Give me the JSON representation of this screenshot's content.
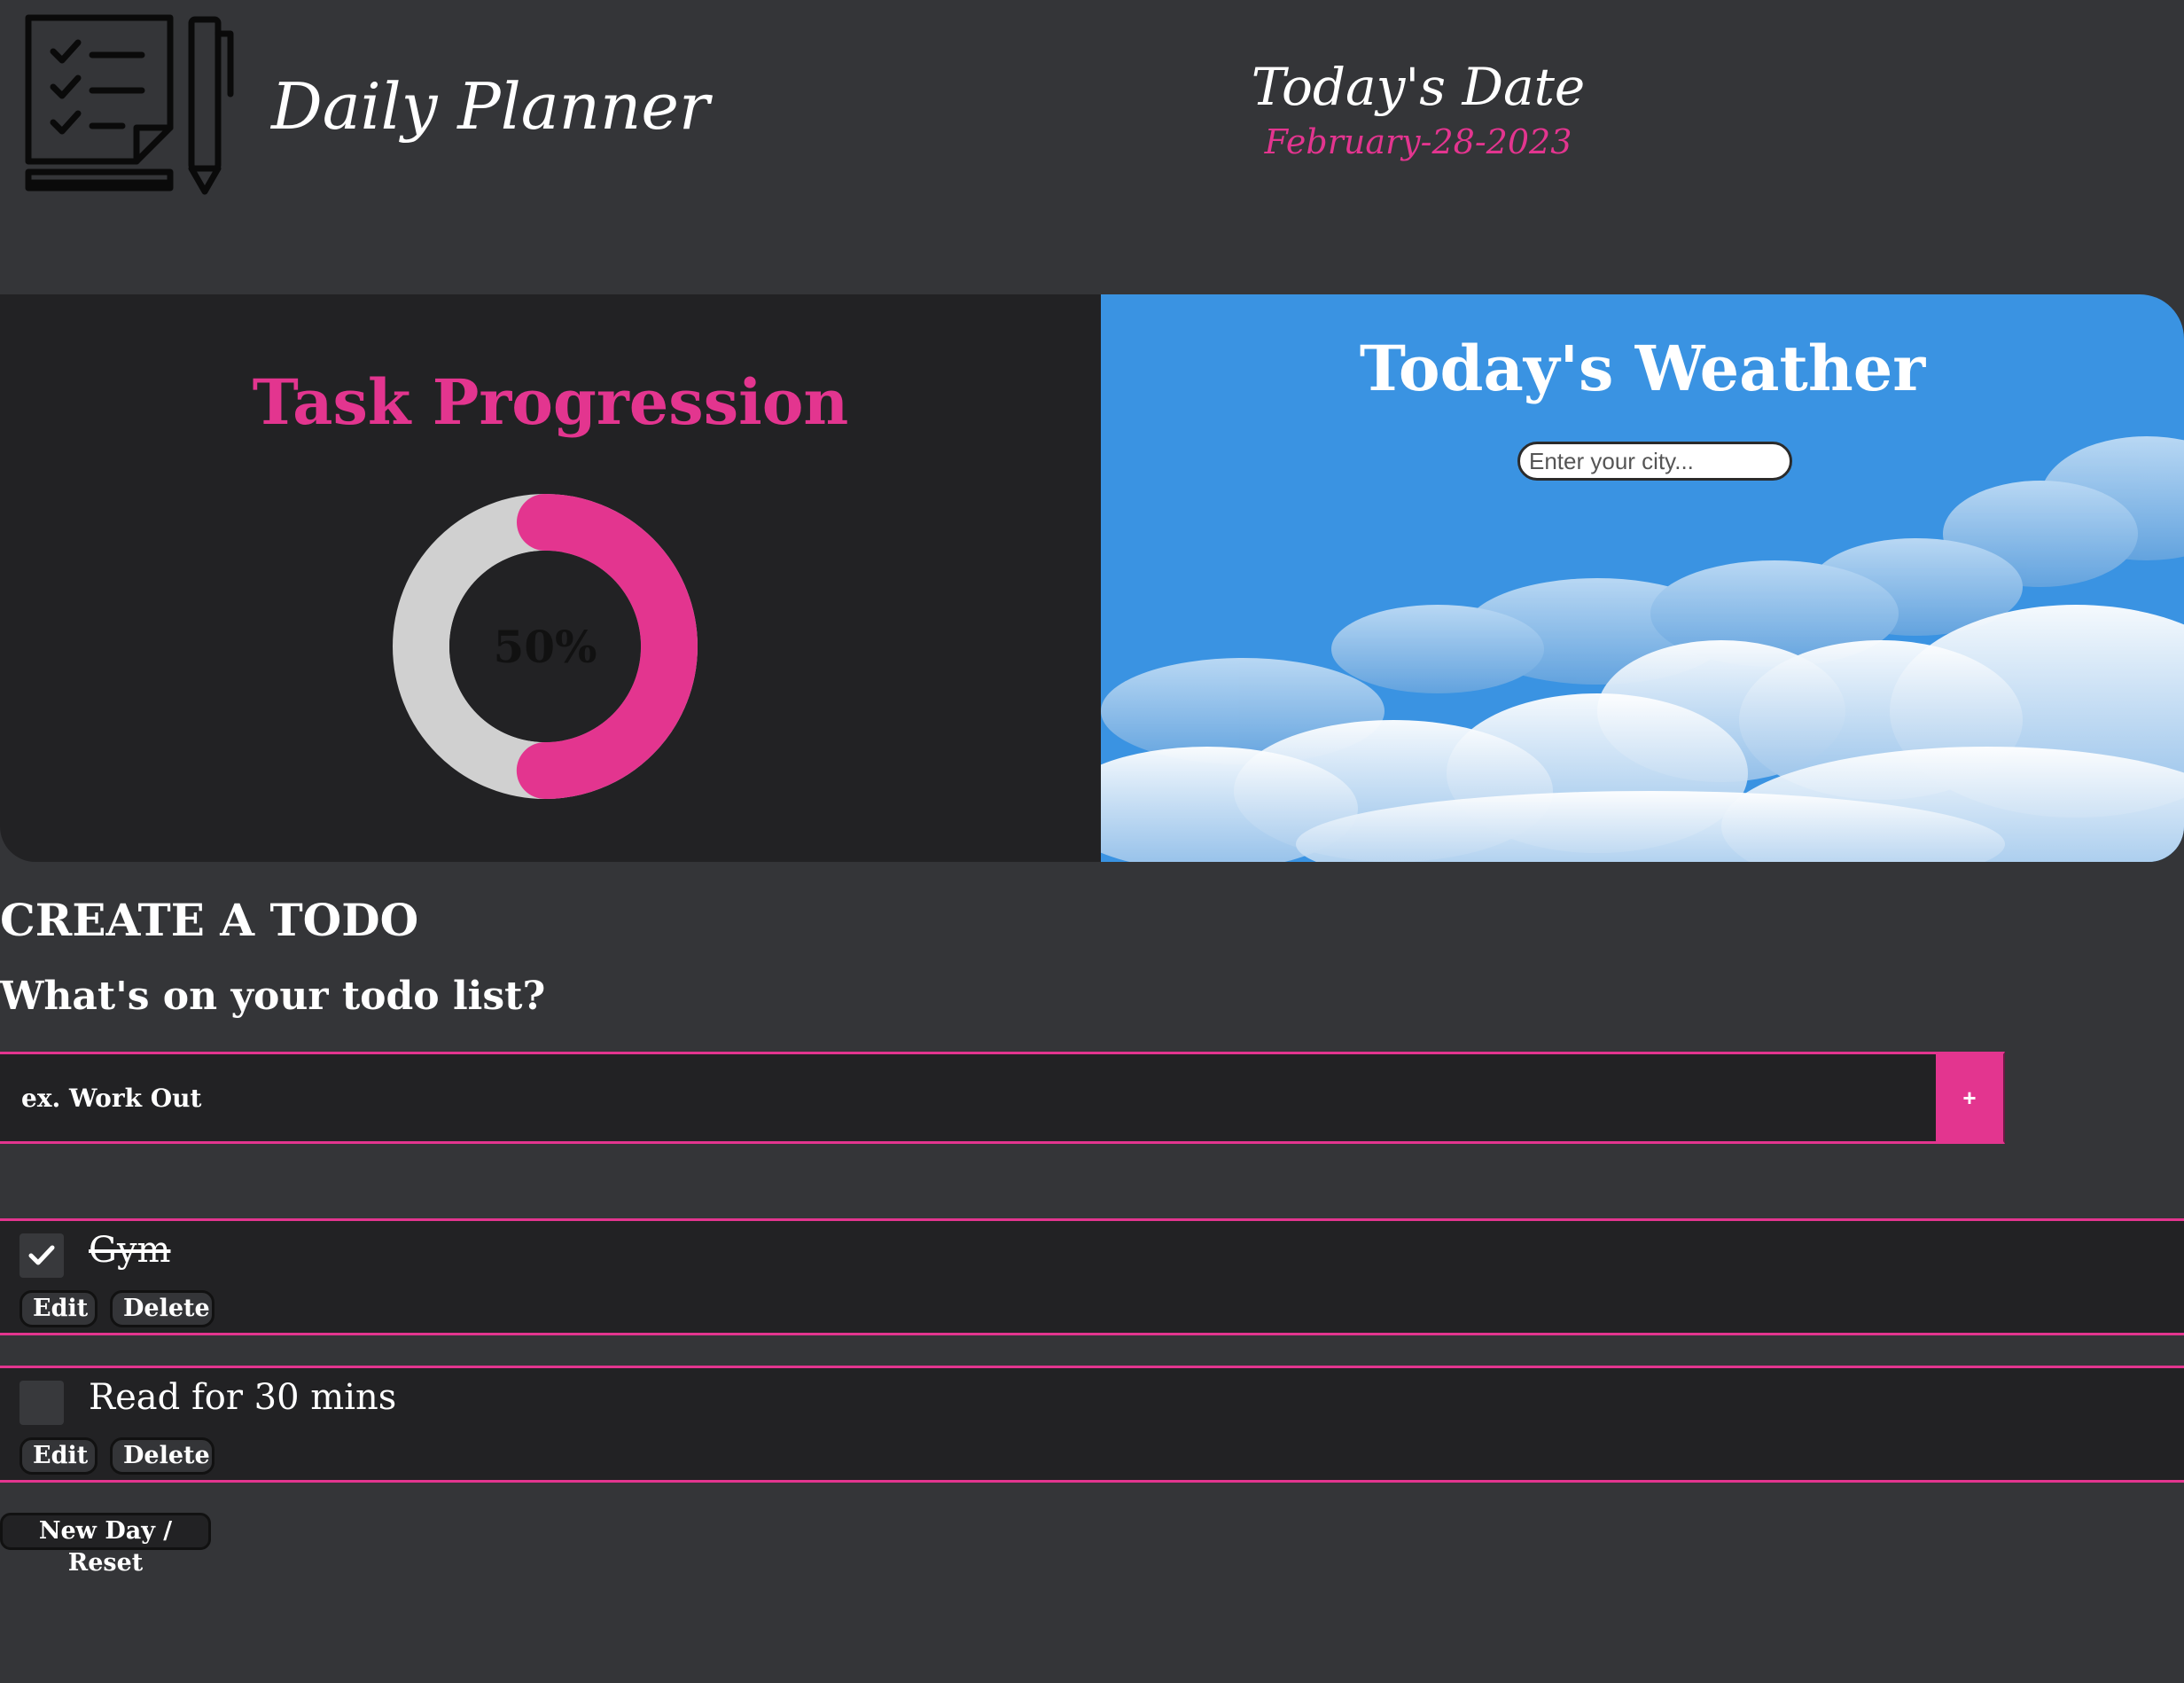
{
  "header": {
    "app_title": "Daily Planner",
    "date_heading": "Today's Date",
    "date_value": "February-28-2023",
    "logo_icon": "checklist-notepad-pen-icon"
  },
  "progress": {
    "title": "Task Progression",
    "percent_label": "50%",
    "fraction": 0.5,
    "fill_color": "#e3358f",
    "track_color": "#d0d0d0"
  },
  "weather": {
    "title": "Today's Weather",
    "city_placeholder": "Enter your city...",
    "background_color": "#3a93e2"
  },
  "create": {
    "heading": "CREATE A TODO",
    "subheading": "What's on your todo list?",
    "input_placeholder": "ex. Work Out",
    "add_label": "+"
  },
  "todos": [
    {
      "text": "Gym",
      "done": true,
      "edit_label": "Edit",
      "delete_label": "Delete"
    },
    {
      "text": "Read for 30 mins",
      "done": false,
      "edit_label": "Edit",
      "delete_label": "Delete"
    }
  ],
  "reset_label": "New Day / Reset",
  "colors": {
    "accent": "#e3358f",
    "page_background": "#343538",
    "panel_background": "#222224"
  }
}
